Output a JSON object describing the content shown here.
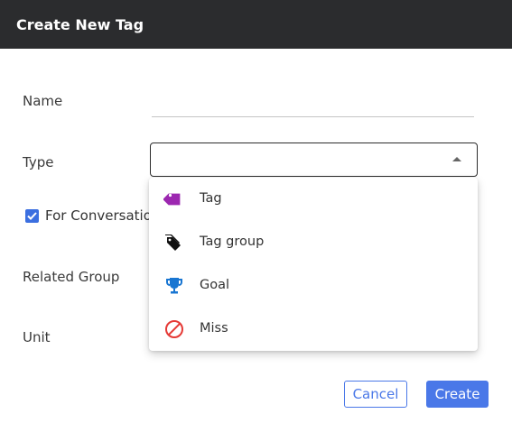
{
  "dialog": {
    "title": "Create New Tag"
  },
  "form": {
    "name_label": "Name",
    "type_label": "Type",
    "for_conversation_label": "For Conversatio",
    "related_group_label": "Related Group",
    "unit_label": "Unit"
  },
  "type_options": [
    {
      "label": "Tag",
      "icon": "tag-icon",
      "color": "#9c27b0"
    },
    {
      "label": "Tag group",
      "icon": "tags-icon",
      "color": "#111111"
    },
    {
      "label": "Goal",
      "icon": "trophy-icon",
      "color": "#1976d2"
    },
    {
      "label": "Miss",
      "icon": "block-icon",
      "color": "#e53935"
    }
  ],
  "buttons": {
    "cancel": "Cancel",
    "create": "Create"
  },
  "colors": {
    "accent": "#4a78e8",
    "titlebar": "#2b2c2e",
    "checkbox": "#3b6fe0"
  }
}
